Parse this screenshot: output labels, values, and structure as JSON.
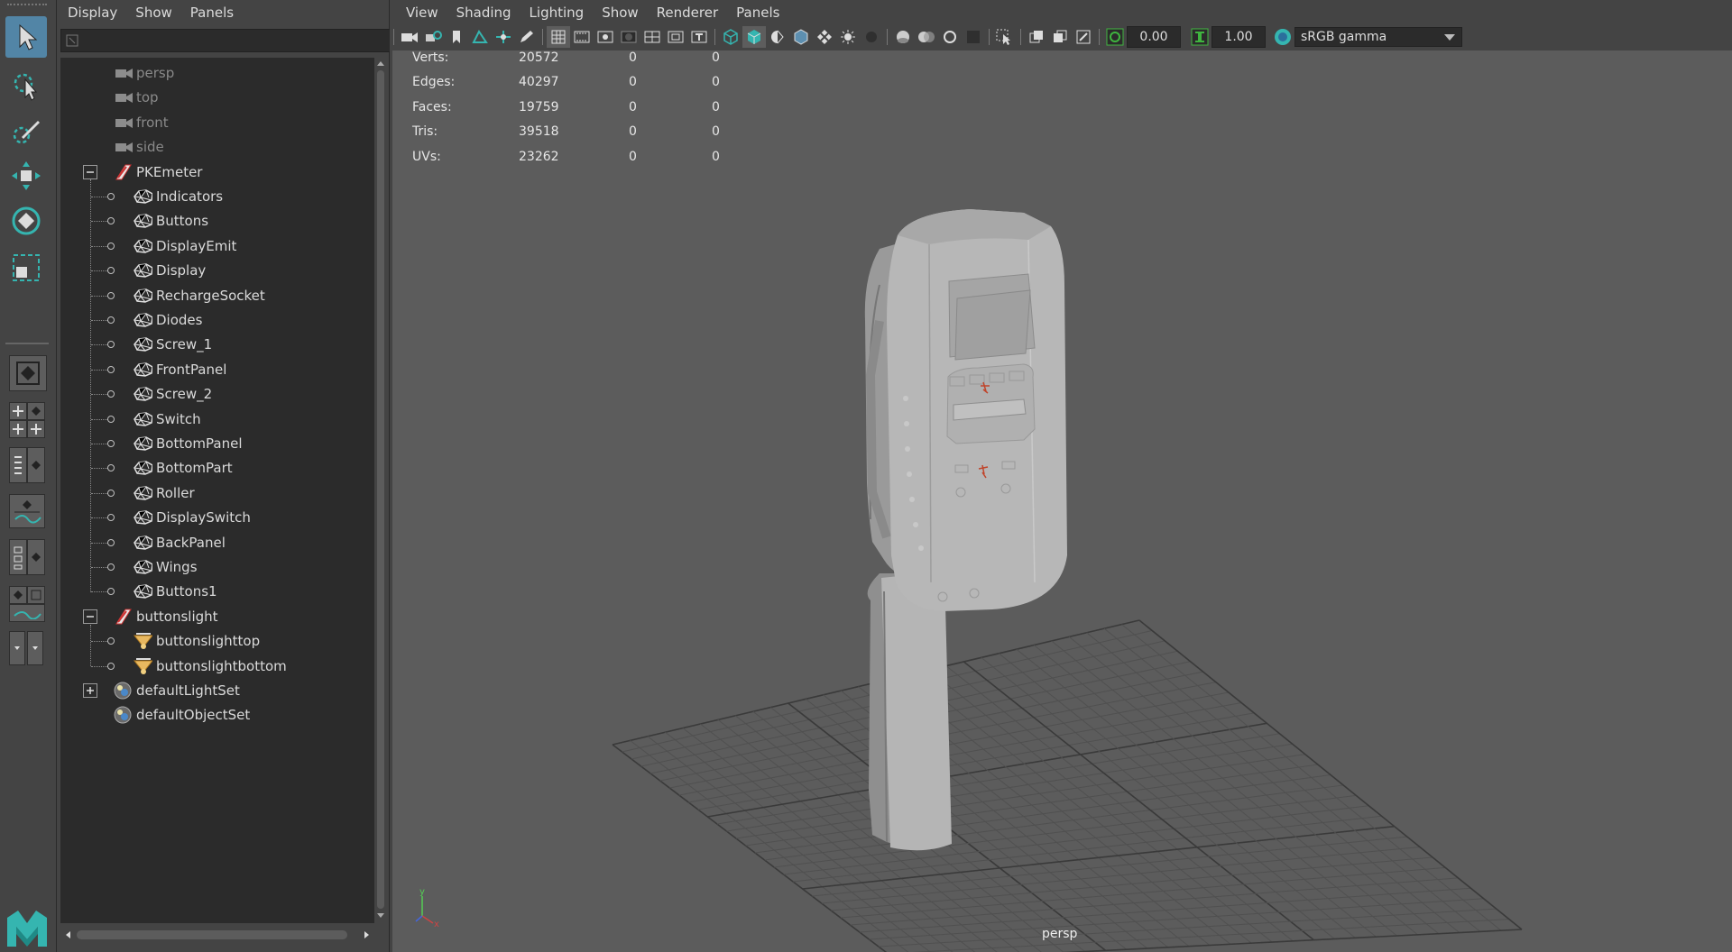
{
  "outliner": {
    "menu": [
      "Display",
      "Show",
      "Panels"
    ],
    "search_placeholder": "",
    "items": [
      {
        "label": "persp",
        "type": "camera",
        "dim": true
      },
      {
        "label": "top",
        "type": "camera",
        "dim": true
      },
      {
        "label": "front",
        "type": "camera",
        "dim": true
      },
      {
        "label": "side",
        "type": "camera",
        "dim": true
      },
      {
        "label": "PKEmeter",
        "type": "group",
        "expanded": true
      },
      {
        "label": "Indicators",
        "type": "mesh"
      },
      {
        "label": "Buttons",
        "type": "mesh"
      },
      {
        "label": "DisplayEmit",
        "type": "mesh"
      },
      {
        "label": "Display",
        "type": "mesh"
      },
      {
        "label": "RechargeSocket",
        "type": "mesh"
      },
      {
        "label": "Diodes",
        "type": "mesh"
      },
      {
        "label": "Screw_1",
        "type": "mesh"
      },
      {
        "label": "FrontPanel",
        "type": "mesh"
      },
      {
        "label": "Screw_2",
        "type": "mesh"
      },
      {
        "label": "Switch",
        "type": "mesh"
      },
      {
        "label": "BottomPanel",
        "type": "mesh"
      },
      {
        "label": "BottomPart",
        "type": "mesh"
      },
      {
        "label": "Roller",
        "type": "mesh"
      },
      {
        "label": "DisplaySwitch",
        "type": "mesh"
      },
      {
        "label": "BackPanel",
        "type": "mesh"
      },
      {
        "label": "Wings",
        "type": "mesh"
      },
      {
        "label": "Buttons1",
        "type": "mesh"
      },
      {
        "label": "buttonslight",
        "type": "group",
        "expanded": true
      },
      {
        "label": "buttonslighttop",
        "type": "light"
      },
      {
        "label": "buttonslightbottom",
        "type": "light"
      },
      {
        "label": "defaultLightSet",
        "type": "set",
        "expanded": false
      },
      {
        "label": "defaultObjectSet",
        "type": "set"
      }
    ]
  },
  "viewport": {
    "menu": [
      "View",
      "Shading",
      "Lighting",
      "Show",
      "Renderer",
      "Panels"
    ],
    "exposure": "0.00",
    "gamma": "1.00",
    "color_space": "sRGB gamma",
    "camera_label": "persp",
    "hud": [
      {
        "label": "Verts:",
        "value": "20572",
        "sel": "0",
        "comp": "0"
      },
      {
        "label": "Edges:",
        "value": "40297",
        "sel": "0",
        "comp": "0"
      },
      {
        "label": "Faces:",
        "value": "19759",
        "sel": "0",
        "comp": "0"
      },
      {
        "label": "Tris:",
        "value": "39518",
        "sel": "0",
        "comp": "0"
      },
      {
        "label": "UVs:",
        "value": "23262",
        "sel": "0",
        "comp": "0"
      }
    ],
    "axis_labels": {
      "y": "y",
      "x": "x"
    }
  },
  "colors": {
    "accent": "#5285a6",
    "logo": "#35b5b0",
    "viewport_bg": "#5c5c5c",
    "grid": "#505050",
    "grid_major": "#3a3a3a",
    "model": "#b8b8b8",
    "model_marks": "#c0442a"
  },
  "toolbox": {
    "tools": [
      "select-tool",
      "lasso-tool",
      "paint-select-tool",
      "move-tool",
      "rotate-tool",
      "scale-tool"
    ]
  }
}
